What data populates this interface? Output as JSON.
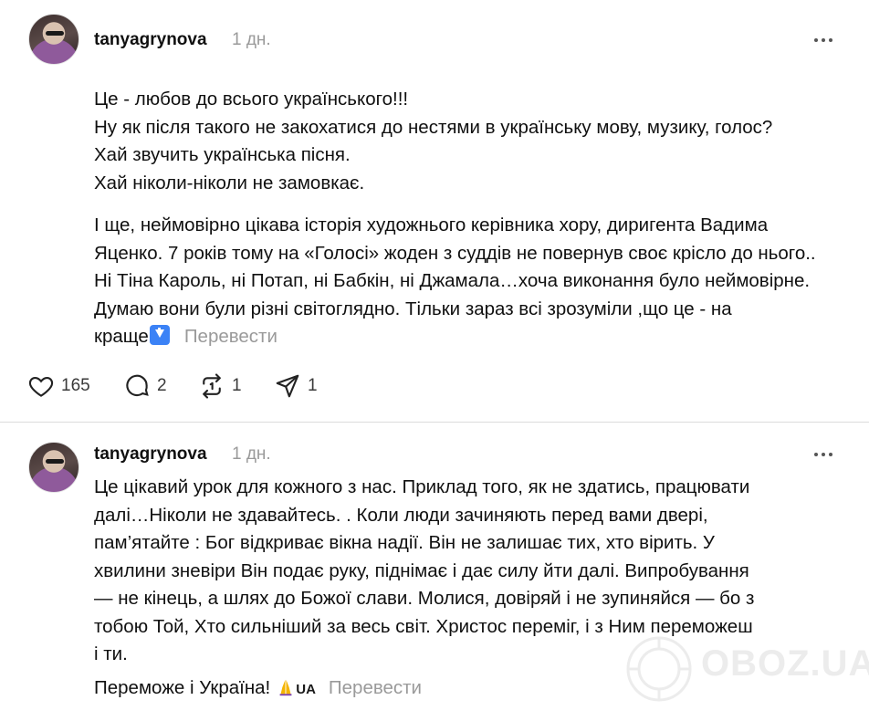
{
  "posts": [
    {
      "username": "tanyagrynova",
      "time": "1 дн.",
      "paragraph1": "Це - любов до всього українського!!!\nНу як після такого не закохатися до нестями в українську мову, музику, голос?\nХай звучить українська пісня.\nХай ніколи-ніколи не замовкає.",
      "paragraph2": "І ще, неймовірно цікава історія художнього керівника хору, диригента Вадима\nЯценко. 7 років тому на «Голосі» жоден з суддів не повернув своє крісло до нього..\nНі Тіна Кароль, ні Потап, ні Бабкін, ні Джамала…хоча виконання було неймовірне.\nДумаю вони були різні світоглядно. Тільки зараз всі зрозуміли ,що це - на\nкраще",
      "translate_label": "Перевести",
      "likes": "165",
      "comments": "2",
      "reposts": "1",
      "shares": "1"
    },
    {
      "username": "tanyagrynova",
      "time": "1 дн.",
      "body": "Це цікавий урок для кожного з нас. Приклад того, як не здатись, працювати\nдалі…Ніколи не здавайтесь. . Коли люди зачиняють перед вами двері,\nпам’ятайте : Бог відкриває вікна надії. Він не залишає тих, хто вірить. У\nхвилини зневіри Він подає руку, піднімає і дає силу йти далі. Випробування\n— не кінець, а шлях до Божої слави. Молися, довіряй і не зупиняйся — бо з\nтобою Той, Хто сильніший за весь світ. Христос переміг, і з Ним переможеш\nі ти.",
      "last_line": "Переможе і Україна!",
      "ua_tag": "UA",
      "translate_label": "Перевести"
    }
  ],
  "watermark": "OBOZ.UA",
  "icons": {
    "more": "more-horizontal-icon",
    "like": "heart-icon",
    "comment": "comment-bubble-icon",
    "repost": "repost-icon",
    "share": "send-icon",
    "emoji_arrow": "down-arrow-emoji",
    "emoji_pray": "praying-hands-emoji"
  }
}
